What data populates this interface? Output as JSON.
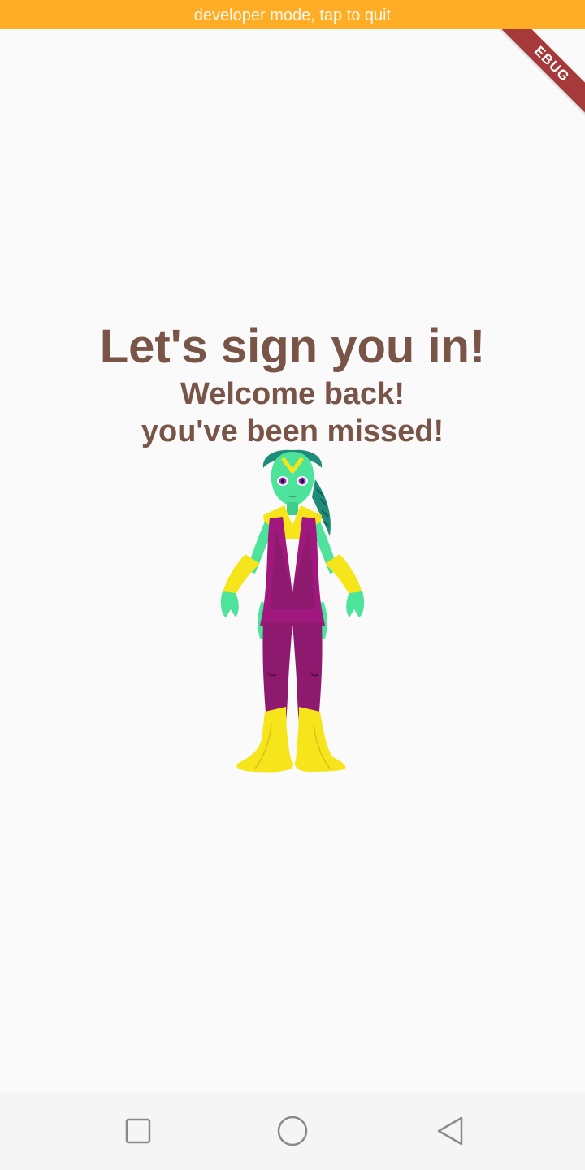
{
  "dev_banner": {
    "text": "developer mode, tap to quit",
    "color": "#ffad25"
  },
  "debug_ribbon": {
    "text": "EBUG",
    "color": "#a63a3a"
  },
  "login": {
    "title": "Let's sign you in!",
    "subtitle_line1": "Welcome back!",
    "subtitle_line2": "you've been missed!",
    "text_color": "#795548"
  },
  "illustration": {
    "icon": "alien-character-illustration",
    "colors": {
      "skin": "#4de39a",
      "suit": "#a0187e",
      "accent": "#f7e51b"
    }
  },
  "nav_bar": {
    "recents_icon": "square-icon",
    "home_icon": "circle-icon",
    "back_icon": "triangle-back-icon"
  }
}
